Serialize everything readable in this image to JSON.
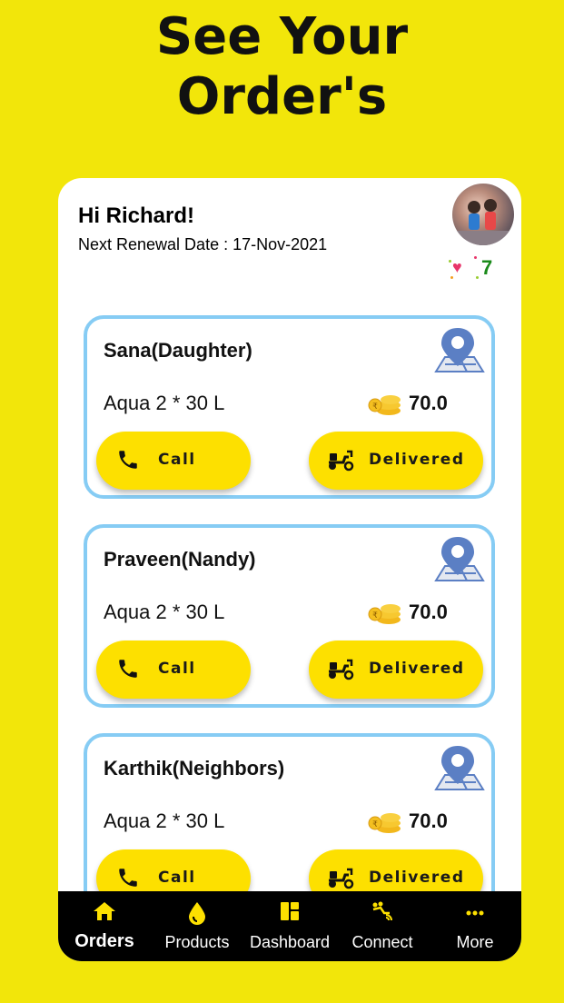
{
  "headline": {
    "line1": "See Your",
    "line2": "Order's"
  },
  "header": {
    "greeting": "Hi Richard!",
    "renewal": "Next Renewal Date : 17-Nov-2021",
    "likes_count": "7"
  },
  "orders": [
    {
      "name": "Sana(Daughter)",
      "product": "Aqua 2 * 30 L",
      "price": "70.0",
      "call_label": "Call",
      "status_label": "Delivered"
    },
    {
      "name": "Praveen(Nandy)",
      "product": "Aqua 2 * 30 L",
      "price": "70.0",
      "call_label": "Call",
      "status_label": "Delivered"
    },
    {
      "name": "Karthik(Neighbors)",
      "product": "Aqua 2 * 30 L",
      "price": "70.0",
      "call_label": "Call",
      "status_label": "Delivered"
    }
  ],
  "bottom_nav": {
    "items": [
      {
        "label": "Orders",
        "icon": "home-icon"
      },
      {
        "label": "Products",
        "icon": "water-drop-icon"
      },
      {
        "label": "Dashboard",
        "icon": "dashboard-icon"
      },
      {
        "label": "Connect",
        "icon": "connect-icon"
      },
      {
        "label": "More",
        "icon": "more-icon"
      }
    ],
    "active_index": 0
  },
  "colors": {
    "background": "#f2e60a",
    "accent_yellow": "#fde000",
    "card_border": "#86ccf4",
    "pin_blue": "#5b7fc4",
    "likes_green": "#1a8a1a",
    "heart_pink": "#e8356a"
  }
}
